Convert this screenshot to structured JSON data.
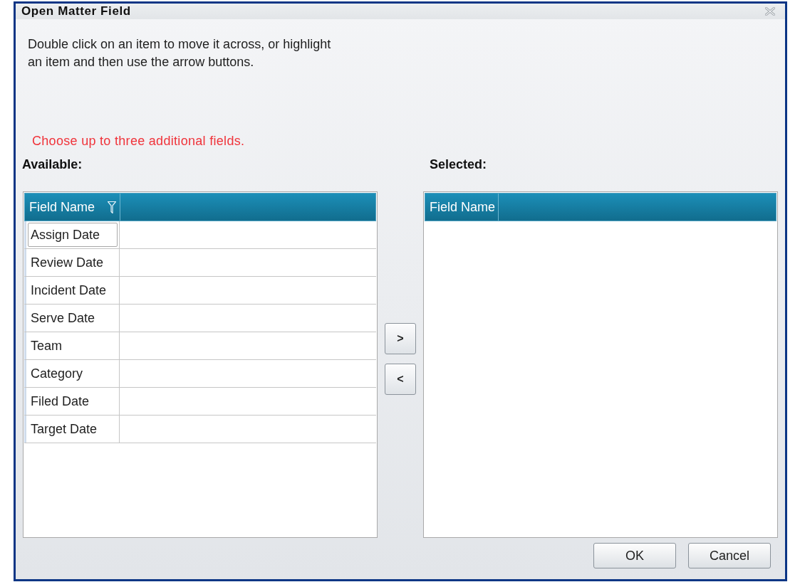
{
  "window": {
    "title": "Open Matter Field"
  },
  "instructions": "Double click on an item to move it across, or highlight an item and then use the arrow buttons.",
  "notice": "Choose up to three additional fields.",
  "available": {
    "label": "Available:",
    "columns": [
      {
        "title": "Field Name",
        "filter": true
      }
    ],
    "rows": [
      {
        "field_name": "Assign Date",
        "focused": true
      },
      {
        "field_name": "Review Date",
        "focused": false
      },
      {
        "field_name": "Incident Date",
        "focused": false
      },
      {
        "field_name": "Serve Date",
        "focused": false
      },
      {
        "field_name": "Team",
        "focused": false
      },
      {
        "field_name": "Category",
        "focused": false
      },
      {
        "field_name": "Filed Date",
        "focused": false
      },
      {
        "field_name": "Target Date",
        "focused": false
      }
    ]
  },
  "move_buttons": [
    ">",
    "<"
  ],
  "selected": {
    "label": "Selected:",
    "columns": [
      {
        "title": "Field Name",
        "filter": false
      }
    ]
  },
  "buttons": [
    "OK",
    "Cancel"
  ]
}
